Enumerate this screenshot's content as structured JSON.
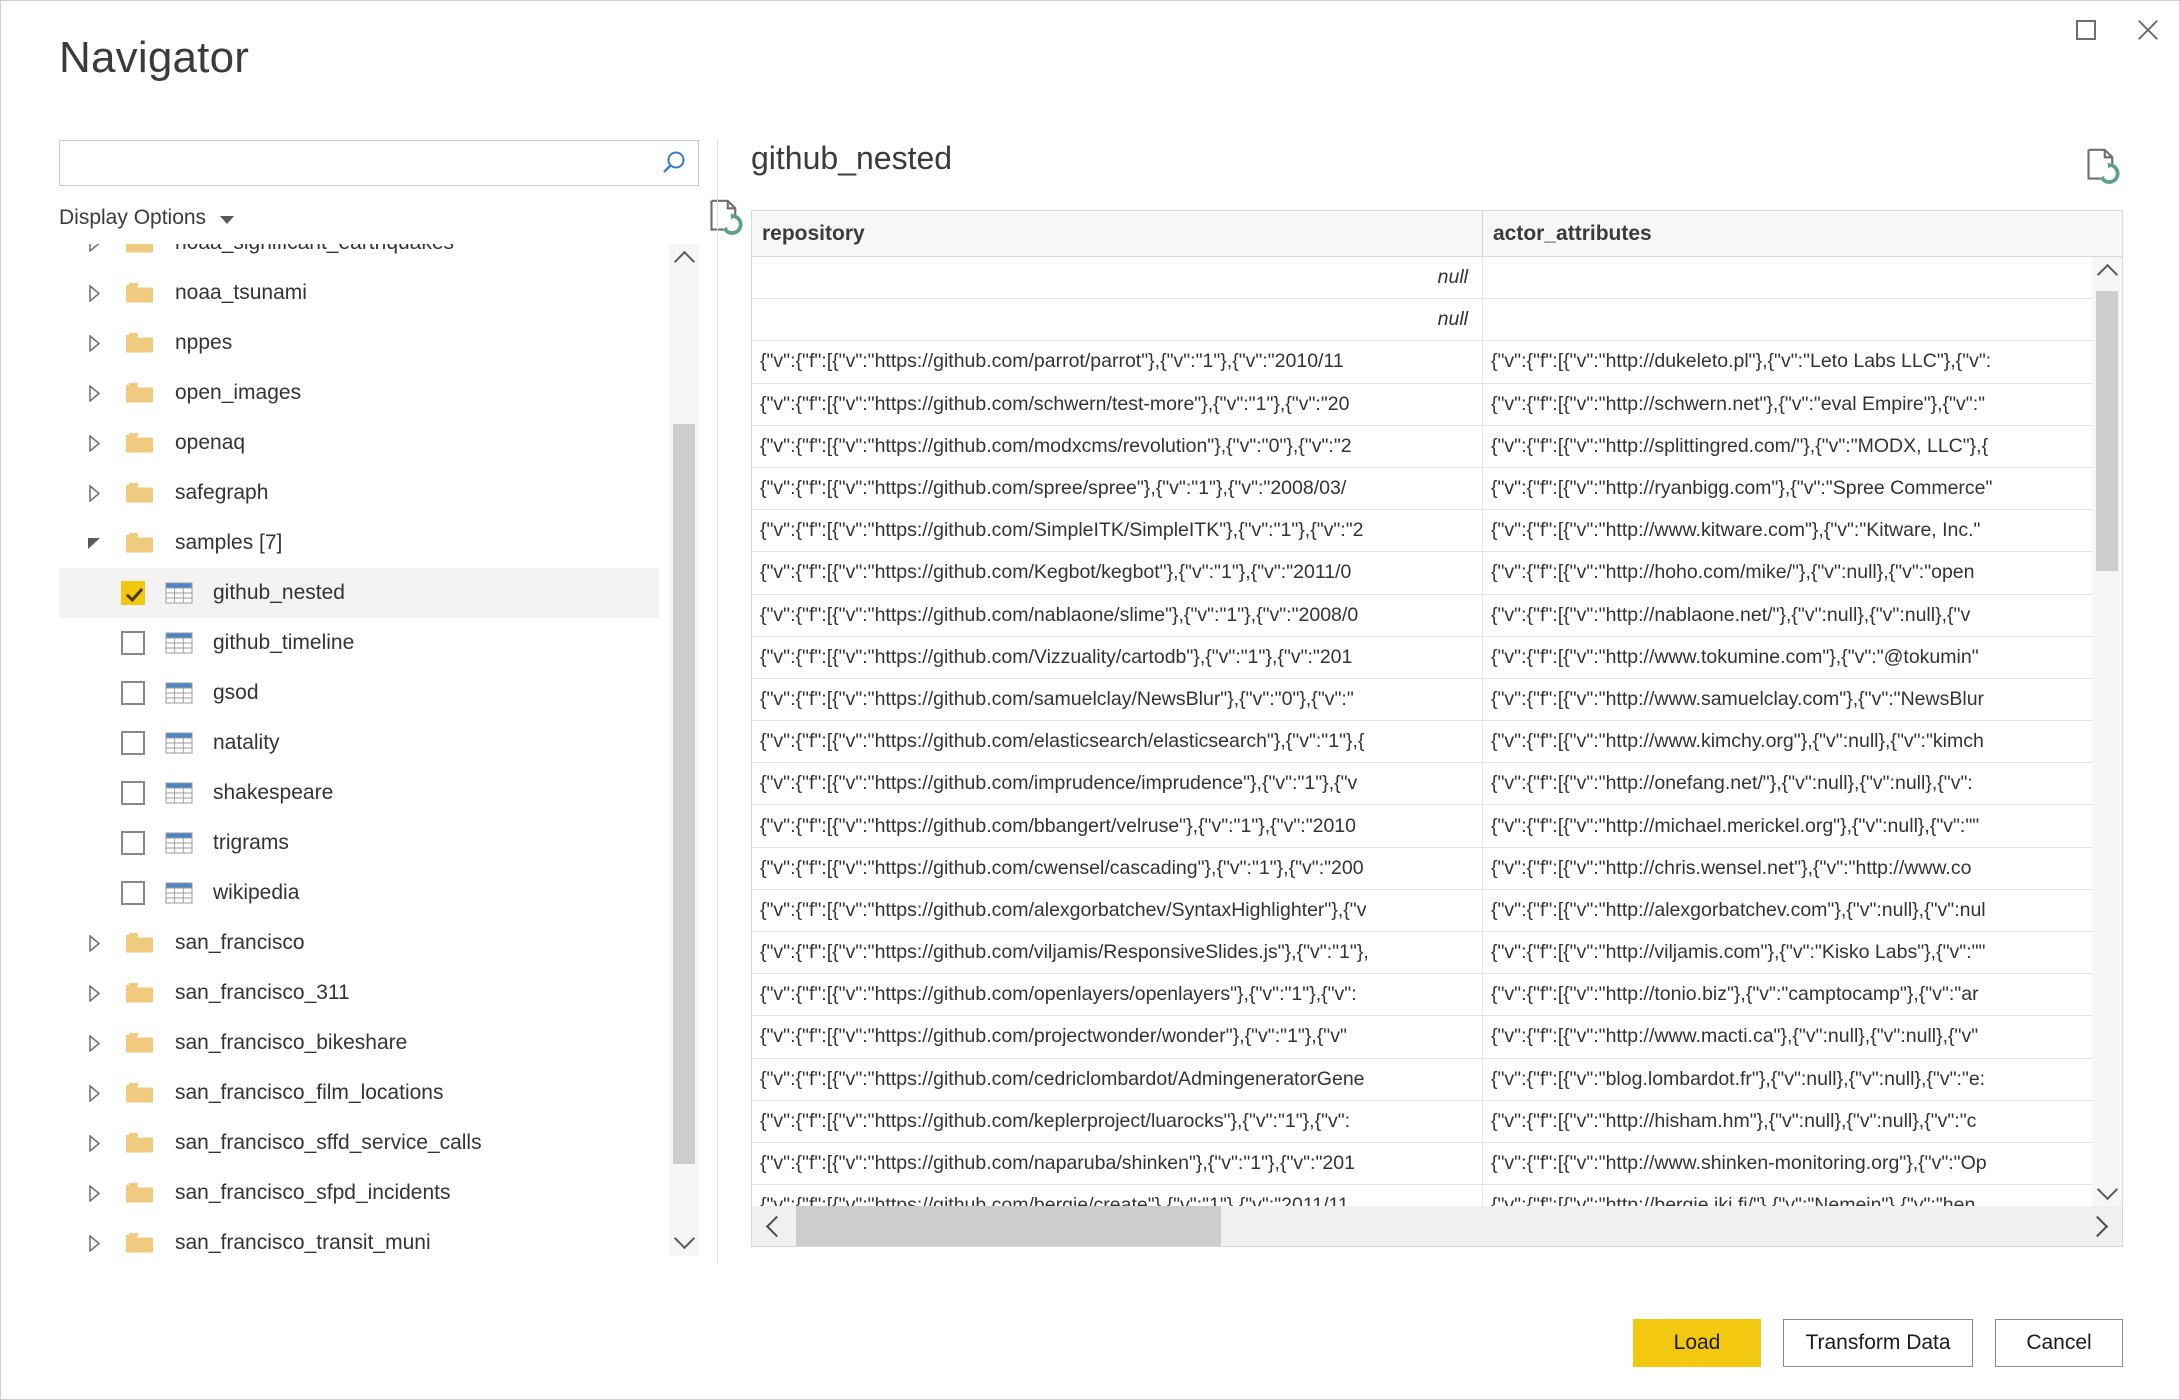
{
  "window": {
    "title": "Navigator",
    "maximize_icon": "square-icon",
    "close_icon": "close-icon"
  },
  "left": {
    "search": {
      "value": "",
      "placeholder": "",
      "icon": "search-icon"
    },
    "display_options_label": "Display Options",
    "display_options_caret": "chevron-down-icon",
    "refresh_icon": "refresh-document-icon",
    "scroll_up_icon": "chevron-up-icon",
    "scroll_down_icon": "chevron-down-icon",
    "tree": [
      {
        "label": "noaa_significant_earthquakes",
        "type": "folder",
        "state": "collapsed",
        "indent": 0,
        "clipped": true
      },
      {
        "label": "noaa_tsunami",
        "type": "folder",
        "state": "collapsed",
        "indent": 0
      },
      {
        "label": "nppes",
        "type": "folder",
        "state": "collapsed",
        "indent": 0
      },
      {
        "label": "open_images",
        "type": "folder",
        "state": "collapsed",
        "indent": 0
      },
      {
        "label": "openaq",
        "type": "folder",
        "state": "collapsed",
        "indent": 0
      },
      {
        "label": "safegraph",
        "type": "folder",
        "state": "collapsed",
        "indent": 0
      },
      {
        "label": "samples [7]",
        "type": "folder",
        "state": "expanded",
        "indent": 0
      },
      {
        "label": "github_nested",
        "type": "table",
        "checked": true,
        "selected": true,
        "indent": 1
      },
      {
        "label": "github_timeline",
        "type": "table",
        "checked": false,
        "indent": 1
      },
      {
        "label": "gsod",
        "type": "table",
        "checked": false,
        "indent": 1
      },
      {
        "label": "natality",
        "type": "table",
        "checked": false,
        "indent": 1
      },
      {
        "label": "shakespeare",
        "type": "table",
        "checked": false,
        "indent": 1
      },
      {
        "label": "trigrams",
        "type": "table",
        "checked": false,
        "indent": 1
      },
      {
        "label": "wikipedia",
        "type": "table",
        "checked": false,
        "indent": 1
      },
      {
        "label": "san_francisco",
        "type": "folder",
        "state": "collapsed",
        "indent": 0
      },
      {
        "label": "san_francisco_311",
        "type": "folder",
        "state": "collapsed",
        "indent": 0
      },
      {
        "label": "san_francisco_bikeshare",
        "type": "folder",
        "state": "collapsed",
        "indent": 0
      },
      {
        "label": "san_francisco_film_locations",
        "type": "folder",
        "state": "collapsed",
        "indent": 0
      },
      {
        "label": "san_francisco_sffd_service_calls",
        "type": "folder",
        "state": "collapsed",
        "indent": 0
      },
      {
        "label": "san_francisco_sfpd_incidents",
        "type": "folder",
        "state": "collapsed",
        "indent": 0
      },
      {
        "label": "san_francisco_transit_muni",
        "type": "folder",
        "state": "collapsed",
        "indent": 0
      }
    ]
  },
  "preview": {
    "title": "github_nested",
    "refresh_icon": "refresh-document-icon",
    "columns": [
      "repository",
      "actor_attributes"
    ],
    "rows": [
      {
        "repository": "null",
        "repository_is_null": true,
        "actor_attributes": ""
      },
      {
        "repository": "null",
        "repository_is_null": true,
        "actor_attributes": ""
      },
      {
        "repository": "{\"v\":{\"f\":[{\"v\":\"https://github.com/parrot/parrot\"},{\"v\":\"1\"},{\"v\":\"2010/11",
        "actor_attributes": "{\"v\":{\"f\":[{\"v\":\"http://dukeleto.pl\"},{\"v\":\"Leto Labs LLC\"},{\"v\":"
      },
      {
        "repository": "{\"v\":{\"f\":[{\"v\":\"https://github.com/schwern/test-more\"},{\"v\":\"1\"},{\"v\":\"20",
        "actor_attributes": "{\"v\":{\"f\":[{\"v\":\"http://schwern.net\"},{\"v\":\"eval Empire\"},{\"v\":\""
      },
      {
        "repository": "{\"v\":{\"f\":[{\"v\":\"https://github.com/modxcms/revolution\"},{\"v\":\"0\"},{\"v\":\"2",
        "actor_attributes": "{\"v\":{\"f\":[{\"v\":\"http://splittingred.com/\"},{\"v\":\"MODX, LLC\"},{"
      },
      {
        "repository": "{\"v\":{\"f\":[{\"v\":\"https://github.com/spree/spree\"},{\"v\":\"1\"},{\"v\":\"2008/03/",
        "actor_attributes": "{\"v\":{\"f\":[{\"v\":\"http://ryanbigg.com\"},{\"v\":\"Spree Commerce\""
      },
      {
        "repository": "{\"v\":{\"f\":[{\"v\":\"https://github.com/SimpleITK/SimpleITK\"},{\"v\":\"1\"},{\"v\":\"2",
        "actor_attributes": "{\"v\":{\"f\":[{\"v\":\"http://www.kitware.com\"},{\"v\":\"Kitware, Inc.\""
      },
      {
        "repository": "{\"v\":{\"f\":[{\"v\":\"https://github.com/Kegbot/kegbot\"},{\"v\":\"1\"},{\"v\":\"2011/0",
        "actor_attributes": "{\"v\":{\"f\":[{\"v\":\"http://hoho.com/mike/\"},{\"v\":null},{\"v\":\"open"
      },
      {
        "repository": "{\"v\":{\"f\":[{\"v\":\"https://github.com/nablaone/slime\"},{\"v\":\"1\"},{\"v\":\"2008/0",
        "actor_attributes": "{\"v\":{\"f\":[{\"v\":\"http://nablaone.net/\"},{\"v\":null},{\"v\":null},{\"v"
      },
      {
        "repository": "{\"v\":{\"f\":[{\"v\":\"https://github.com/Vizzuality/cartodb\"},{\"v\":\"1\"},{\"v\":\"201",
        "actor_attributes": "{\"v\":{\"f\":[{\"v\":\"http://www.tokumine.com\"},{\"v\":\"@tokumin\""
      },
      {
        "repository": "{\"v\":{\"f\":[{\"v\":\"https://github.com/samuelclay/NewsBlur\"},{\"v\":\"0\"},{\"v\":\"",
        "actor_attributes": "{\"v\":{\"f\":[{\"v\":\"http://www.samuelclay.com\"},{\"v\":\"NewsBlur"
      },
      {
        "repository": "{\"v\":{\"f\":[{\"v\":\"https://github.com/elasticsearch/elasticsearch\"},{\"v\":\"1\"},{",
        "actor_attributes": "{\"v\":{\"f\":[{\"v\":\"http://www.kimchy.org\"},{\"v\":null},{\"v\":\"kimch"
      },
      {
        "repository": "{\"v\":{\"f\":[{\"v\":\"https://github.com/imprudence/imprudence\"},{\"v\":\"1\"},{\"v",
        "actor_attributes": "{\"v\":{\"f\":[{\"v\":\"http://onefang.net/\"},{\"v\":null},{\"v\":null},{\"v\":"
      },
      {
        "repository": "{\"v\":{\"f\":[{\"v\":\"https://github.com/bbangert/velruse\"},{\"v\":\"1\"},{\"v\":\"2010",
        "actor_attributes": "{\"v\":{\"f\":[{\"v\":\"http://michael.merickel.org\"},{\"v\":null},{\"v\":\"\""
      },
      {
        "repository": "{\"v\":{\"f\":[{\"v\":\"https://github.com/cwensel/cascading\"},{\"v\":\"1\"},{\"v\":\"200",
        "actor_attributes": "{\"v\":{\"f\":[{\"v\":\"http://chris.wensel.net\"},{\"v\":\"http://www.co"
      },
      {
        "repository": "{\"v\":{\"f\":[{\"v\":\"https://github.com/alexgorbatchev/SyntaxHighlighter\"},{\"v",
        "actor_attributes": "{\"v\":{\"f\":[{\"v\":\"http://alexgorbatchev.com\"},{\"v\":null},{\"v\":nul"
      },
      {
        "repository": "{\"v\":{\"f\":[{\"v\":\"https://github.com/viljamis/ResponsiveSlides.js\"},{\"v\":\"1\"},",
        "actor_attributes": "{\"v\":{\"f\":[{\"v\":\"http://viljamis.com\"},{\"v\":\"Kisko Labs\"},{\"v\":\"\""
      },
      {
        "repository": "{\"v\":{\"f\":[{\"v\":\"https://github.com/openlayers/openlayers\"},{\"v\":\"1\"},{\"v\":",
        "actor_attributes": "{\"v\":{\"f\":[{\"v\":\"http://tonio.biz\"},{\"v\":\"camptocamp\"},{\"v\":\"ar"
      },
      {
        "repository": "{\"v\":{\"f\":[{\"v\":\"https://github.com/projectwonder/wonder\"},{\"v\":\"1\"},{\"v\"",
        "actor_attributes": "{\"v\":{\"f\":[{\"v\":\"http://www.macti.ca\"},{\"v\":null},{\"v\":null},{\"v\""
      },
      {
        "repository": "{\"v\":{\"f\":[{\"v\":\"https://github.com/cedriclombardot/AdmingeneratorGene",
        "actor_attributes": "{\"v\":{\"f\":[{\"v\":\"blog.lombardot.fr\"},{\"v\":null},{\"v\":null},{\"v\":\"e:"
      },
      {
        "repository": "{\"v\":{\"f\":[{\"v\":\"https://github.com/keplerproject/luarocks\"},{\"v\":\"1\"},{\"v\":",
        "actor_attributes": "{\"v\":{\"f\":[{\"v\":\"http://hisham.hm\"},{\"v\":null},{\"v\":null},{\"v\":\"c"
      },
      {
        "repository": "{\"v\":{\"f\":[{\"v\":\"https://github.com/naparuba/shinken\"},{\"v\":\"1\"},{\"v\":\"201",
        "actor_attributes": "{\"v\":{\"f\":[{\"v\":\"http://www.shinken-monitoring.org\"},{\"v\":\"Op"
      },
      {
        "repository": "{\"v\":{\"f\":[{\"v\":\"https://github.com/bergie/create\"},{\"v\":\"1\"},{\"v\":\"2011/11",
        "actor_attributes": "{\"v\":{\"f\":[{\"v\":\"http://bergie.iki.fi/\"},{\"v\":\"Nemein\"},{\"v\":\"hen"
      }
    ],
    "hscroll_left_icon": "chevron-left-icon",
    "hscroll_right_icon": "chevron-right-icon"
  },
  "footer": {
    "load_label": "Load",
    "transform_label": "Transform Data",
    "cancel_label": "Cancel"
  },
  "colors": {
    "accent_yellow": "#f2c811",
    "folder": "#f0ca7e",
    "table_header_blue": "#4a86c5",
    "search_blue": "#3a7ebf",
    "refresh_green": "#5f9e8a"
  }
}
